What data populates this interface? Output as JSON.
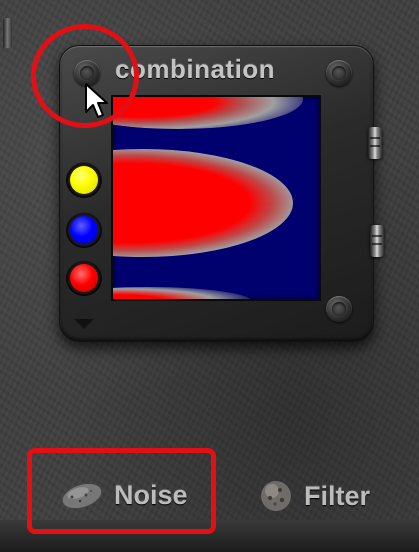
{
  "panel": {
    "title": "combination",
    "color_buttons": [
      {
        "name": "yellow",
        "color": "#ffff00"
      },
      {
        "name": "blue",
        "color": "#0000ff"
      },
      {
        "name": "red",
        "color": "#ff0000"
      }
    ],
    "preview_colors": {
      "background": "#00006e",
      "foreground": "#ff0000",
      "blend": "#a0a0a0"
    }
  },
  "bottom_nav": {
    "noise_label": "Noise",
    "filter_label": "Filter"
  },
  "annotation_color": "#e40f14"
}
